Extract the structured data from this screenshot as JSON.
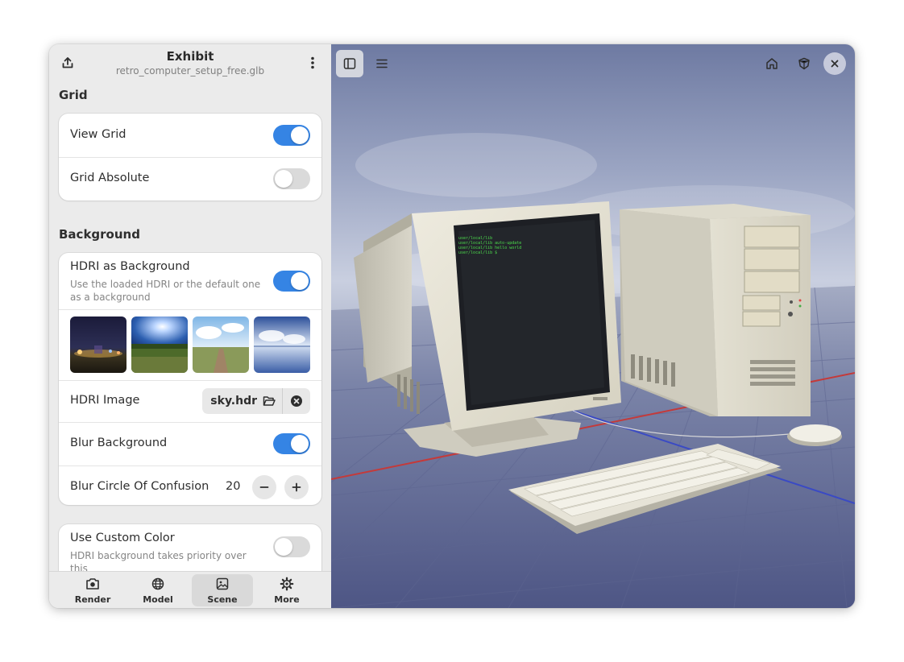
{
  "header": {
    "title": "Exhibit",
    "subtitle": "retro_computer_setup_free.glb",
    "export_icon": "share-export-icon",
    "menu_icon": "kebab-menu-icon"
  },
  "grid_section": {
    "title": "Grid",
    "view_grid": {
      "label": "View Grid",
      "on": true
    },
    "grid_absolute": {
      "label": "Grid Absolute",
      "on": false
    }
  },
  "background_section": {
    "title": "Background",
    "hdri_bg": {
      "label": "HDRI as Background",
      "description": "Use the loaded HDRI or the default one as a background",
      "on": true
    },
    "thumbnails": [
      "night-city-hdri",
      "sunny-field-hdri",
      "cloudy-road-hdri",
      "sky-water-hdri"
    ],
    "hdri_image": {
      "label": "HDRI Image",
      "file": "sky.hdr"
    },
    "blur_bg": {
      "label": "Blur Background",
      "on": true
    },
    "blur_coc": {
      "label": "Blur Circle Of Confusion",
      "value": "20"
    },
    "custom_color": {
      "label": "Use Custom Color",
      "description": "HDRI background takes priority over this",
      "on": false
    }
  },
  "bottom_tabs": [
    {
      "label": "Render",
      "icon": "camera-icon"
    },
    {
      "label": "Model",
      "icon": "globe-icon"
    },
    {
      "label": "Scene",
      "icon": "image-icon",
      "active": true
    },
    {
      "label": "More",
      "icon": "gear-icon"
    }
  ],
  "viewport": {
    "terminal_lines": [
      "user/local/lib",
      "user/local/lib auto-update",
      "user/local/lib hello world",
      "user/local/lib $"
    ],
    "toolbar_icons": [
      "sidebar-toggle-icon",
      "hamburger-menu-icon",
      "home-icon",
      "shield-icon",
      "close-icon"
    ]
  },
  "colors": {
    "accent": "#3584e4",
    "sidebar_bg": "#ebebeb",
    "card_bg": "#ffffff",
    "terminal_green": "#4cdd4c"
  }
}
